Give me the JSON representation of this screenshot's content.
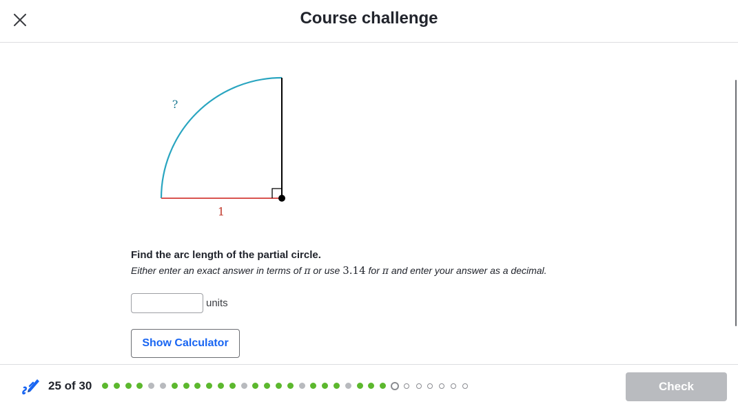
{
  "header": {
    "title": "Course challenge",
    "close_icon": "close-icon"
  },
  "figure": {
    "arc_label": "?",
    "radius_label": "1",
    "arc_color": "#29a5c0",
    "radius_color": "#d9534f",
    "line_color": "#000000"
  },
  "question": {
    "title": "Find the arc length of the partial circle.",
    "sub_before_pi1": "Either enter an exact answer in terms of ",
    "pi_symbol": "π",
    "sub_middle_1": " or use ",
    "approx_value": "3.14",
    "sub_middle_2": " for ",
    "sub_after": " and enter your answer as a decimal."
  },
  "answer": {
    "value": "",
    "placeholder": "",
    "units": "units"
  },
  "buttons": {
    "calculator_label": "Show Calculator",
    "check_label": "Check"
  },
  "footer": {
    "icon": "pencil-icon",
    "progress_text": "25 of 30",
    "progress_current": 25,
    "progress_total": 30,
    "progress_states": [
      "correct",
      "correct",
      "correct",
      "correct",
      "skipped",
      "skipped",
      "correct",
      "correct",
      "correct",
      "correct",
      "correct",
      "correct",
      "skipped",
      "correct",
      "correct",
      "correct",
      "correct",
      "skipped",
      "correct",
      "correct",
      "correct",
      "skipped",
      "correct",
      "correct",
      "correct",
      "current",
      "upcoming",
      "upcoming",
      "upcoming",
      "upcoming",
      "upcoming",
      "upcoming"
    ]
  },
  "colors": {
    "accent": "#1865f2",
    "correct": "#5cb82e",
    "skipped": "#b8babe",
    "disabled": "#b9bbbf"
  }
}
